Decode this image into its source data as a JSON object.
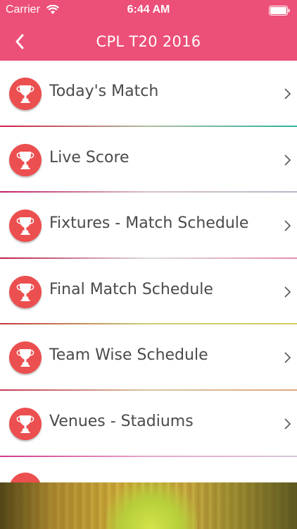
{
  "status_bar": {
    "carrier": "Carrier",
    "time": "6:44 AM",
    "wifi_icon": "wifi-icon",
    "battery_icon": "battery-icon"
  },
  "nav": {
    "title": "CPL T20 2016",
    "back_icon": "chevron-left-icon"
  },
  "colors": {
    "header_bg": "#ec4f78",
    "icon_circle": "#ec4f4f",
    "label_text": "#4a4a4a"
  },
  "menu": {
    "items": [
      {
        "label": "Today's Match",
        "icon": "trophy-icon"
      },
      {
        "label": "Live Score",
        "icon": "trophy-icon"
      },
      {
        "label": "Fixtures - Match Schedule",
        "icon": "trophy-icon"
      },
      {
        "label": "Final Match Schedule",
        "icon": "trophy-icon"
      },
      {
        "label": "Team Wise Schedule",
        "icon": "trophy-icon"
      },
      {
        "label": "Venues - Stadiums",
        "icon": "trophy-icon"
      }
    ]
  }
}
